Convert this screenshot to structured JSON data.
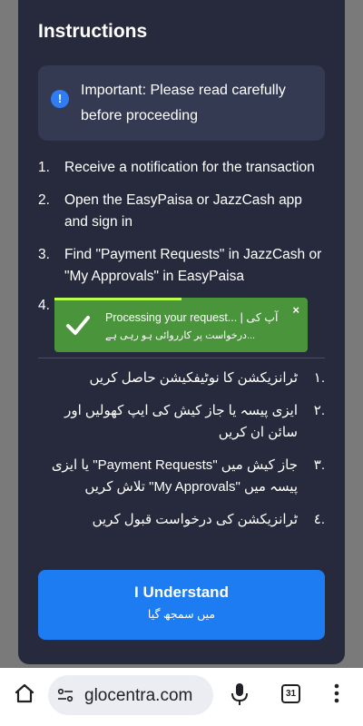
{
  "modal": {
    "title": "Instructions",
    "important": "Important: Please read carefully before proceeding",
    "steps": [
      {
        "num": "1.",
        "text": "Receive a notification for the transaction"
      },
      {
        "num": "2.",
        "text": "Open the EasyPaisa or JazzCash app and sign in"
      },
      {
        "num": "3.",
        "text": "Find \"Payment Requests\" in JazzCash or \"My Approvals\" in EasyPaisa"
      },
      {
        "num": "4.",
        "text": ""
      }
    ],
    "urdu_steps": [
      {
        "num": ".١",
        "text": "ٹرانزیکشن کا نوٹیفکیشن حاصل کریں"
      },
      {
        "num": ".٢",
        "text": "ایزی پیسہ یا جاز کیش کی ایپ کھولیں اور سائن ان کریں"
      },
      {
        "num": ".٣",
        "text": "جاز کیش میں \"Payment Requests\" یا ایزی پیسہ میں \"My Approvals\" تلاش کریں"
      },
      {
        "num": ".٤",
        "text": "ٹرانزیکشن کی درخواست قبول کریں"
      }
    ],
    "button_label": "I Understand",
    "button_sublabel": "میں سمجھ گیا"
  },
  "toast": {
    "line1": "Processing your request... | آپ کی",
    "line2": "درخواست پر کارروائی ہو رہی ہے...",
    "close": "×",
    "progress": 0.5
  },
  "browser": {
    "url": "glocentra.com",
    "tab_count": "31"
  },
  "colors": {
    "modal_bg": "#272a3d",
    "accent": "#1e7cf2",
    "toast_bg": "#4a953c"
  },
  "icons": [
    "info-icon",
    "check-icon",
    "close-icon",
    "home-icon",
    "tune-icon",
    "mic-icon",
    "tabs-icon",
    "more-vert-icon"
  ]
}
